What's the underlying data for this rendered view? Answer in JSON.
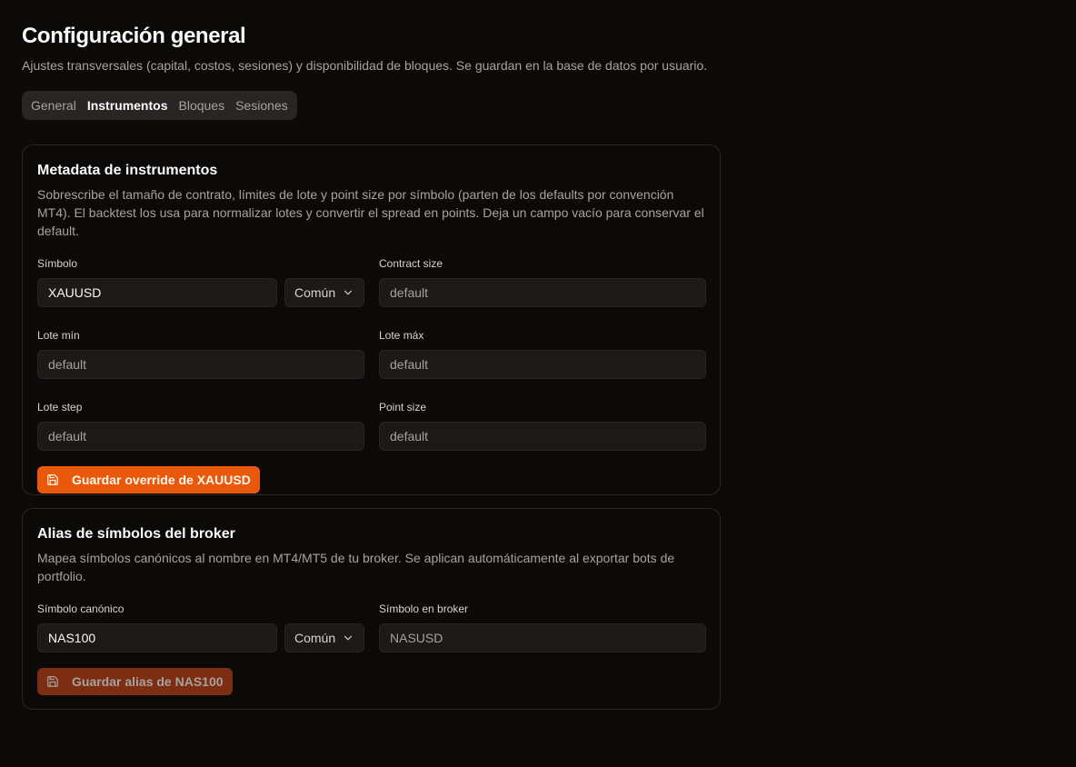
{
  "header": {
    "title": "Configuración general",
    "subtitle": "Ajustes transversales (capital, costos, sesiones) y disponibilidad de bloques. Se guardan en la base de datos por usuario."
  },
  "tabs": [
    {
      "label": "General",
      "active": false
    },
    {
      "label": "Instrumentos",
      "active": true
    },
    {
      "label": "Bloques",
      "active": false
    },
    {
      "label": "Sesiones",
      "active": false
    }
  ],
  "metadata_card": {
    "title": "Metadata de instrumentos",
    "description": "Sobrescribe el tamaño de contrato, límites de lote y point size por símbolo (parten de los defaults por convención MT4). El backtest los usa para normalizar lotes y convertir el spread en points. Deja un campo vacío para conservar el default.",
    "symbol_label": "Símbolo",
    "symbol_value": "XAUUSD",
    "common_select": "Común",
    "contract_size_label": "Contract size",
    "contract_size_placeholder": "default",
    "lot_min_label": "Lote mín",
    "lot_min_placeholder": "default",
    "lot_max_label": "Lote máx",
    "lot_max_placeholder": "default",
    "lot_step_label": "Lote step",
    "lot_step_placeholder": "default",
    "point_size_label": "Point size",
    "point_size_placeholder": "default",
    "save_button": "Guardar override de XAUUSD"
  },
  "alias_card": {
    "title": "Alias de símbolos del broker",
    "description": "Mapea símbolos canónicos al nombre en MT4/MT5 de tu broker. Se aplican automáticamente al exportar bots de portfolio.",
    "canonical_label": "Símbolo canónico",
    "canonical_value": "NAS100",
    "common_select": "Común",
    "broker_label": "Símbolo en broker",
    "broker_placeholder": "NASUSD",
    "save_button": "Guardar alias de NAS100"
  },
  "colors": {
    "background": "#0c0a09",
    "accent": "#ea580c",
    "accent_disabled": "#7c2d12",
    "border": "#292524"
  },
  "icons": {
    "save": "floppy-disk-icon",
    "chevron": "chevron-down-icon"
  }
}
